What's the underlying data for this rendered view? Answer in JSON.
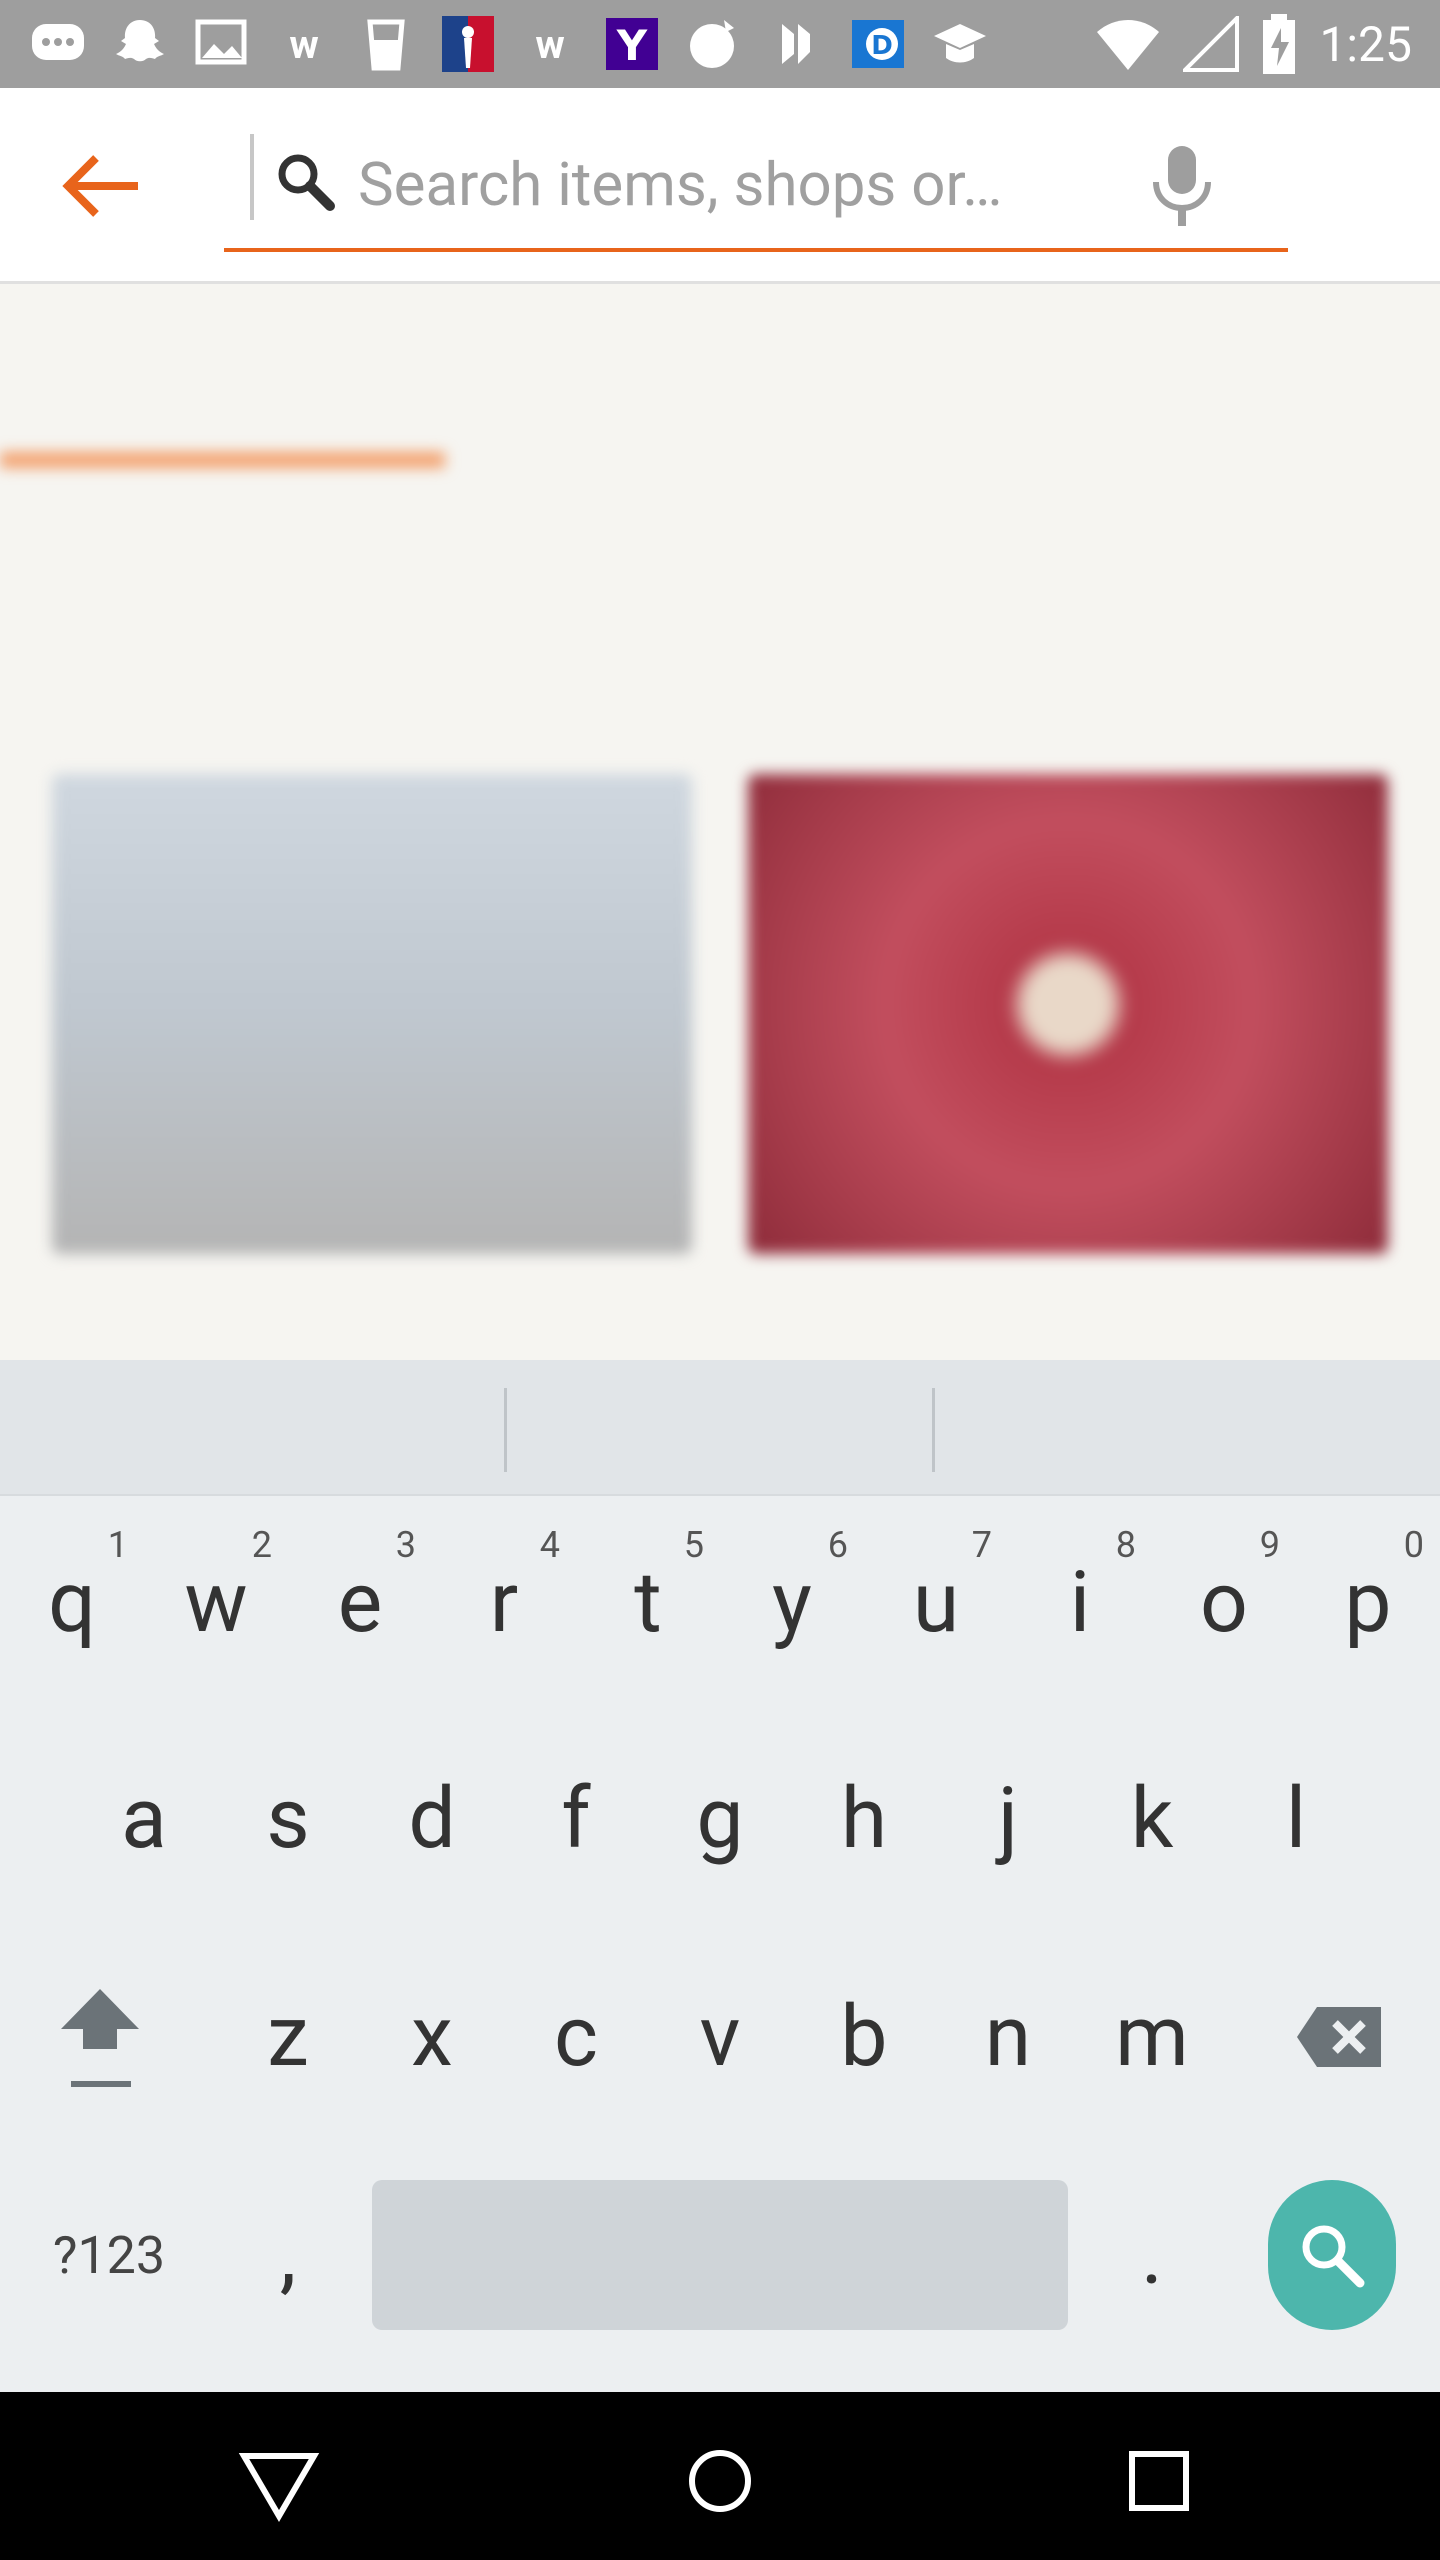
{
  "status_bar": {
    "time": "1:25",
    "notification_icons": [
      "chat-icon",
      "snapchat-icon",
      "gallery-icon",
      "wish-icon",
      "cup-icon",
      "nba-icon",
      "wish-icon",
      "yahoo-icon",
      "app-icon",
      "app-icon",
      "dictionary-icon",
      "graduation-icon"
    ],
    "system_icons": [
      "wifi-icon",
      "cell-signal-icon",
      "battery-charging-icon"
    ]
  },
  "search": {
    "placeholder": "Search items, shops or…"
  },
  "keyboard": {
    "row1": [
      {
        "label": "q",
        "hint": "1"
      },
      {
        "label": "w",
        "hint": "2"
      },
      {
        "label": "e",
        "hint": "3"
      },
      {
        "label": "r",
        "hint": "4"
      },
      {
        "label": "t",
        "hint": "5"
      },
      {
        "label": "y",
        "hint": "6"
      },
      {
        "label": "u",
        "hint": "7"
      },
      {
        "label": "i",
        "hint": "8"
      },
      {
        "label": "o",
        "hint": "9"
      },
      {
        "label": "p",
        "hint": "0"
      }
    ],
    "row2": [
      "a",
      "s",
      "d",
      "f",
      "g",
      "h",
      "j",
      "k",
      "l"
    ],
    "row3": [
      "z",
      "x",
      "c",
      "v",
      "b",
      "n",
      "m"
    ],
    "symbols_label": "?123",
    "comma_label": ",",
    "period_label": "."
  },
  "colors": {
    "accent": "#e8641b",
    "enter_key": "#4db6ac",
    "status_bar": "#9e9e9e"
  }
}
